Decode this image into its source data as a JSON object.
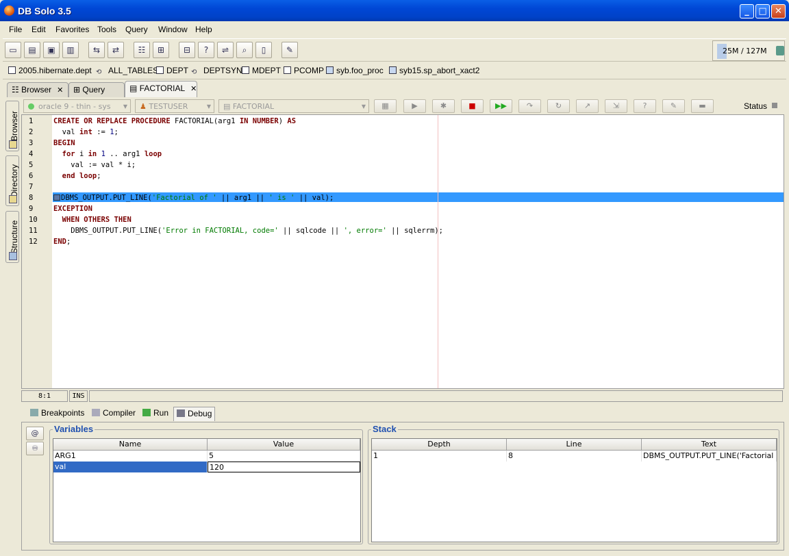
{
  "window": {
    "title": "DB Solo  3.5",
    "min": "_",
    "max": "□",
    "close": "✕"
  },
  "menu": [
    "File",
    "Edit",
    "Favorites",
    "Tools",
    "Query",
    "Window",
    "Help"
  ],
  "memory": {
    "text": "25M / 127M"
  },
  "favorites": [
    "2005.hibernate.dept",
    "ALL_TABLES",
    "DEPT",
    "DEPTSYN",
    "MDEPT",
    "PCOMP",
    "syb.foo_proc",
    "syb15.sp_abort_xact2"
  ],
  "tabs": [
    "Browser",
    "Query",
    "FACTORIAL"
  ],
  "side_tabs": [
    "Browser",
    "Directory",
    "Structure"
  ],
  "query_bar": {
    "connection": "oracle 9 - thin - sys",
    "user": "TESTUSER",
    "object": "FACTORIAL",
    "status_label": "Status"
  },
  "editor": {
    "line_numbers": [
      "1",
      "2",
      "3",
      "4",
      "5",
      "6",
      "7",
      "8",
      "9",
      "10",
      "11",
      "12"
    ],
    "lines": [
      [
        {
          "t": "CREATE OR REPLACE PROCEDURE",
          "c": "kw"
        },
        {
          "t": " FACTORIAL(arg1 ",
          "c": ""
        },
        {
          "t": "IN NUMBER",
          "c": "kw"
        },
        {
          "t": ") ",
          "c": ""
        },
        {
          "t": "AS",
          "c": "kw"
        }
      ],
      [
        {
          "t": "  val ",
          "c": ""
        },
        {
          "t": "int",
          "c": "kw"
        },
        {
          "t": " := ",
          "c": ""
        },
        {
          "t": "1",
          "c": "num"
        },
        {
          "t": ";",
          "c": ""
        }
      ],
      [
        {
          "t": "BEGIN",
          "c": "kw"
        }
      ],
      [
        {
          "t": "  ",
          "c": ""
        },
        {
          "t": "for",
          "c": "kw"
        },
        {
          "t": " i ",
          "c": ""
        },
        {
          "t": "in",
          "c": "kw"
        },
        {
          "t": " ",
          "c": ""
        },
        {
          "t": "1",
          "c": "num"
        },
        {
          "t": " .. arg1 ",
          "c": ""
        },
        {
          "t": "loop",
          "c": "kw"
        }
      ],
      [
        {
          "t": "    val := val * i;",
          "c": ""
        }
      ],
      [
        {
          "t": "  ",
          "c": ""
        },
        {
          "t": "end loop",
          "c": "kw"
        },
        {
          "t": ";",
          "c": ""
        }
      ],
      [
        {
          "t": "",
          "c": ""
        }
      ],
      [
        {
          "t": "DBMS_OUTPUT.PUT_LINE(",
          "c": ""
        },
        {
          "t": "'Factorial of '",
          "c": "str"
        },
        {
          "t": " || arg1 || ",
          "c": ""
        },
        {
          "t": "' is '",
          "c": "str"
        },
        {
          "t": " || val);",
          "c": ""
        }
      ],
      [
        {
          "t": "EXCEPTION",
          "c": "kw"
        }
      ],
      [
        {
          "t": "  ",
          "c": ""
        },
        {
          "t": "WHEN OTHERS THEN",
          "c": "kw"
        }
      ],
      [
        {
          "t": "    DBMS_OUTPUT.PUT_LINE(",
          "c": ""
        },
        {
          "t": "'Error in FACTORIAL, code='",
          "c": "str"
        },
        {
          "t": " || sqlcode || ",
          "c": ""
        },
        {
          "t": "', error='",
          "c": "str"
        },
        {
          "t": " || sqlerrm);",
          "c": ""
        }
      ],
      [
        {
          "t": "END",
          "c": "kw"
        },
        {
          "t": ";",
          "c": ""
        }
      ]
    ],
    "current_line": 8,
    "cursor_pos": "8:1",
    "mode": "INS"
  },
  "bottom_tabs": [
    "Breakpoints",
    "Compiler",
    "Run",
    "Debug"
  ],
  "variables": {
    "title": "Variables",
    "columns": [
      "Name",
      "Value"
    ],
    "rows": [
      [
        "ARG1",
        "5"
      ],
      [
        "val",
        "120"
      ]
    ]
  },
  "stack": {
    "title": "Stack",
    "columns": [
      "Depth",
      "Line",
      "Text"
    ],
    "rows": [
      [
        "1",
        "8",
        "DBMS_OUTPUT.PUT_LINE('Factorial o..."
      ]
    ]
  },
  "icons": {
    "open": "📂",
    "save": "💾",
    "panel_at": "@",
    "panel_watch": "♾"
  }
}
